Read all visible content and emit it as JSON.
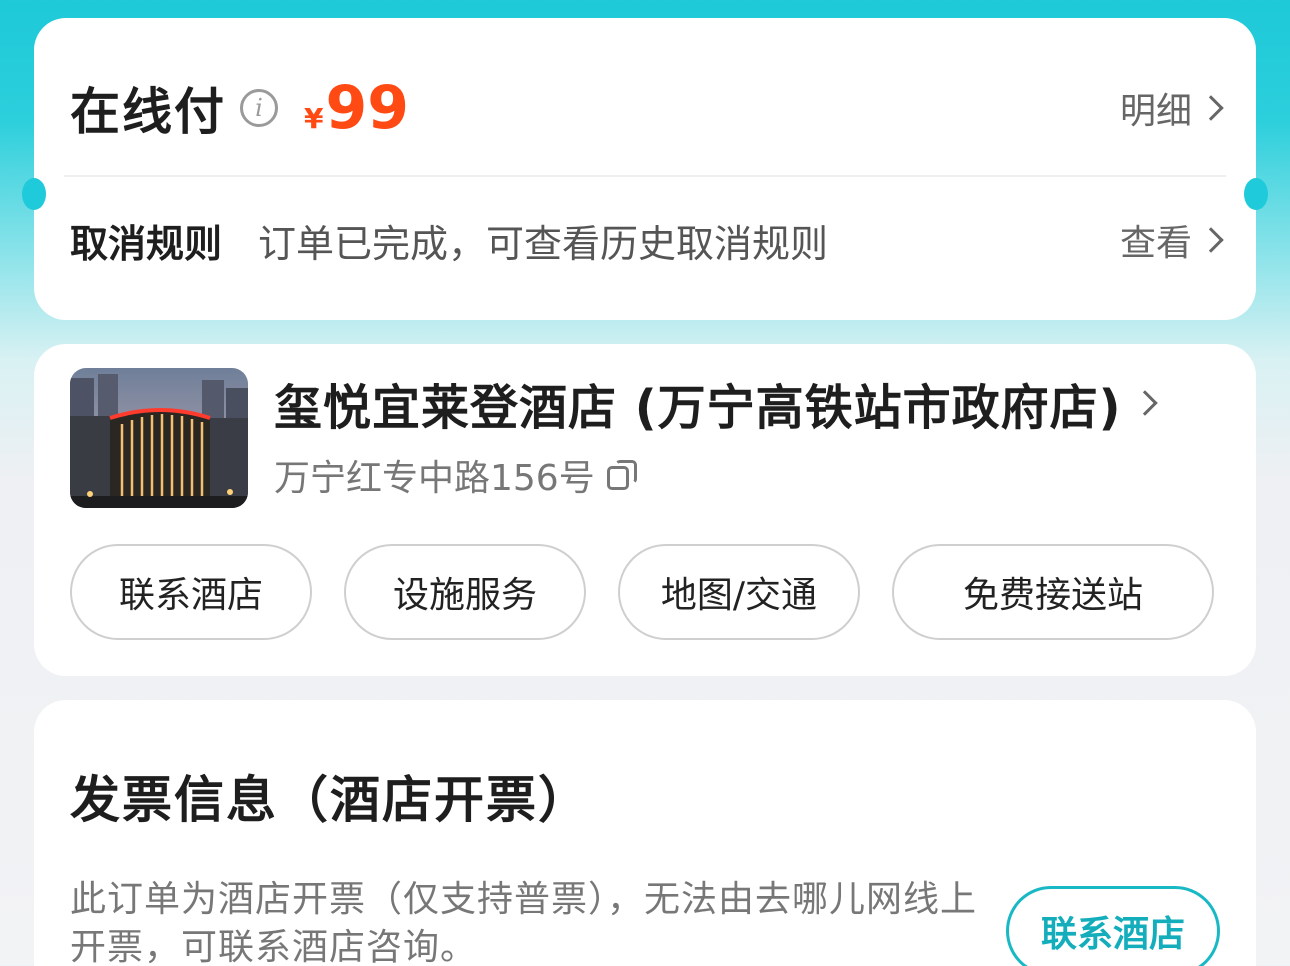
{
  "payment": {
    "title": "在线付",
    "currency_symbol": "¥",
    "amount": "99",
    "detail_link": "明细"
  },
  "cancellation": {
    "label": "取消规则",
    "text": "订单已完成，可查看历史取消规则",
    "view_link": "查看"
  },
  "hotel": {
    "name": "玺悦宜莱登酒店 (万宁高铁站市政府店)",
    "address": "万宁红专中路156号",
    "buttons": [
      "联系酒店",
      "设施服务",
      "地图/交通",
      "免费接送站"
    ]
  },
  "invoice": {
    "title": "发票信息（酒店开票）",
    "description": "此订单为酒店开票（仅支持普票），无法由去哪儿网线上开票，可联系酒店咨询。",
    "contact_button": "联系酒店"
  },
  "colors": {
    "accent": "#1ec9d8",
    "price": "#ff4a14",
    "contact_button": "#13adbb"
  },
  "icons": [
    "info-icon",
    "chevron-right-icon",
    "copy-icon"
  ]
}
